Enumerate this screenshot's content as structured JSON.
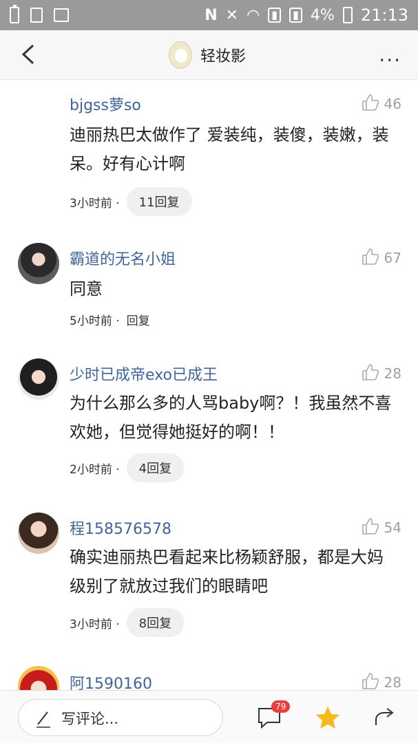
{
  "statusbar": {
    "battery_percent": "4%",
    "time": "21:13",
    "icons": [
      "battery-icon",
      "document-icon",
      "image-icon",
      "nfc-icon",
      "mute-icon",
      "wifi-icon",
      "signal-icon",
      "signal-icon",
      "battery-icon"
    ]
  },
  "navbar": {
    "title": "轻妆影",
    "more": "···"
  },
  "comments": [
    {
      "name": "bjgss萝so",
      "likes": "46",
      "text": "迪丽热巴太做作了 爱装纯，装傻，装嫩，装呆。好有心计啊",
      "time": "3小时前 ·",
      "reply": "11回复"
    },
    {
      "name": "霸道的无名小姐",
      "likes": "67",
      "text": "同意",
      "time": "5小时前 ·",
      "reply": "回复"
    },
    {
      "name": "少时已成帝exo已成王",
      "likes": "28",
      "text": "为什么那么多的人骂baby啊？！我虽然不喜欢她，但觉得她挺好的啊！！",
      "time": "2小时前 ·",
      "reply": "4回复"
    },
    {
      "name": "程158576578",
      "likes": "54",
      "text": "确实迪丽热巴看起来比杨颖舒服，都是大妈级别了就放过我们的眼睛吧",
      "time": "3小时前 ·",
      "reply": "8回复"
    },
    {
      "name": "阿1590160",
      "likes": "28",
      "text": "",
      "time": "",
      "reply": ""
    }
  ],
  "bottombar": {
    "input_placeholder": "写评论...",
    "comment_count": "79"
  },
  "colors": {
    "name_color": "#406599",
    "badge_color": "#e83f3f",
    "star_color": "#f6b81a"
  }
}
